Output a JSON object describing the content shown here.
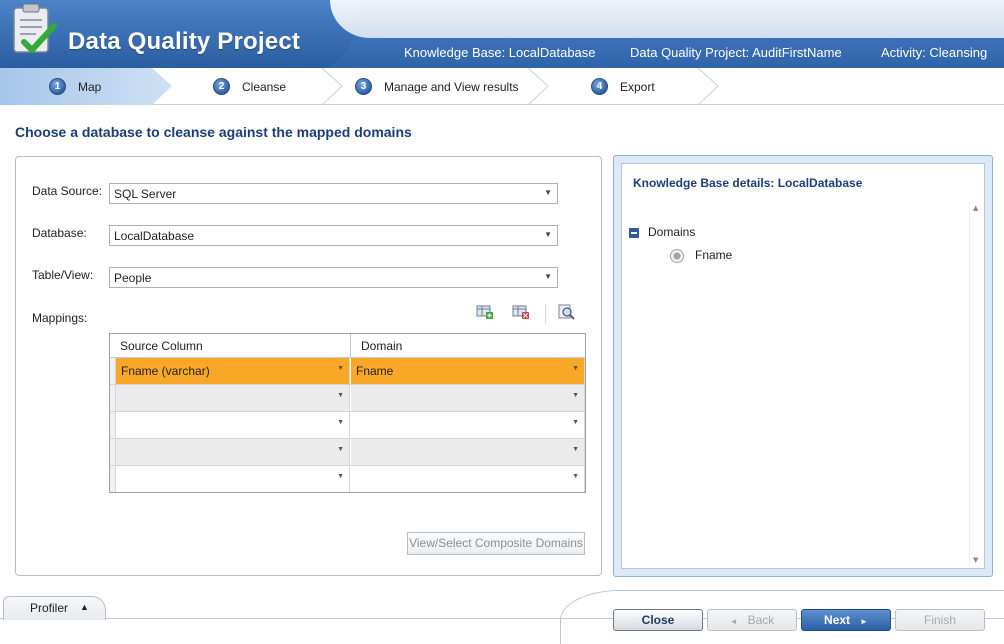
{
  "app": {
    "title": "Data Quality Project"
  },
  "context": {
    "knowledge_base": "Knowledge Base: LocalDatabase",
    "project": "Data Quality Project: AuditFirstName",
    "activity": "Activity: Cleansing"
  },
  "steps": [
    {
      "num": "1",
      "label": "Map"
    },
    {
      "num": "2",
      "label": "Cleanse"
    },
    {
      "num": "3",
      "label": "Manage and View results"
    },
    {
      "num": "4",
      "label": "Export"
    }
  ],
  "page": {
    "title": "Choose a database to cleanse against the mapped domains"
  },
  "form": {
    "data_source_label": "Data Source:",
    "data_source_value": "SQL Server",
    "database_label": "Database:",
    "database_value": "LocalDatabase",
    "table_label": "Table/View:",
    "table_value": "People",
    "mappings_label": "Mappings:"
  },
  "grid": {
    "headers": [
      "Source Column",
      "Domain"
    ],
    "rows": [
      [
        "Fname (varchar)",
        "Fname"
      ],
      [
        "",
        ""
      ],
      [
        "",
        ""
      ],
      [
        "",
        ""
      ],
      [
        "",
        ""
      ]
    ]
  },
  "composite_button": "View/Select Composite Domains",
  "kb_panel": {
    "title": "Knowledge Base details: LocalDatabase",
    "tree_root": "Domains",
    "tree_children": [
      "Fname"
    ]
  },
  "footer": {
    "profiler": "Profiler",
    "close": "Close",
    "back": "Back",
    "next": "Next",
    "finish": "Finish"
  },
  "colors": {
    "header_blue": "#2f63a8",
    "selected_row": "#f8a826",
    "title_navy": "#1d3d78"
  }
}
